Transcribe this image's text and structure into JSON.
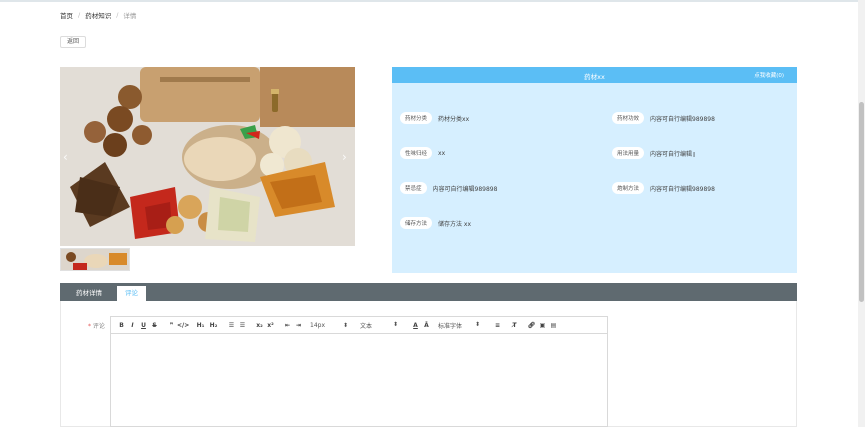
{
  "breadcrumb": [
    "首页",
    "药材知识",
    "详情"
  ],
  "back_label": "返回",
  "product": {
    "title": "药材xx",
    "fav_label": "点我收藏(0)"
  },
  "fields": [
    {
      "label": "药材分类",
      "value": "药材分类xx"
    },
    {
      "label": "药材功效",
      "value": "内容可自行编辑989898"
    },
    {
      "label": "性味归经",
      "value": "xx"
    },
    {
      "label": "用法用量",
      "value": "内容可自行编辑"
    },
    {
      "label": "禁忌症",
      "value": "内容可自行编辑989898"
    },
    {
      "label": "炮制方法",
      "value": "内容可自行编辑989898"
    },
    {
      "label": "储存方法",
      "value": "储存方法 xx"
    }
  ],
  "tabs": [
    "药材详情",
    "评论"
  ],
  "comment": {
    "label": "评论",
    "required_mark": "*"
  },
  "editor": {
    "size": "14px",
    "block": "文本",
    "font": "标准字体"
  },
  "colors": {
    "accent": "#5bbef5",
    "panel_bg": "#d6efff",
    "tabbar": "#5f6a70"
  }
}
